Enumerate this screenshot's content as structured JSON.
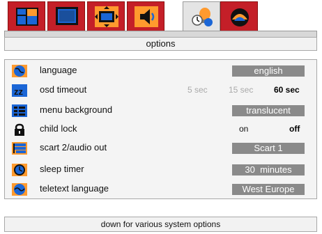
{
  "header": {
    "title": "options"
  },
  "tabs": [
    {
      "icon": "picture-icon",
      "active": false
    },
    {
      "icon": "tv-screen-icon",
      "active": false
    },
    {
      "icon": "screen-format-icon",
      "active": false
    },
    {
      "icon": "sound-icon",
      "active": false
    },
    {
      "icon": "options-bulb-icon",
      "active": true
    },
    {
      "icon": "installation-icon",
      "active": false
    }
  ],
  "settings": {
    "language": {
      "label": "language",
      "value": "english"
    },
    "osd_timeout": {
      "label": "osd timeout",
      "options": [
        "5 sec",
        "15 sec",
        "60 sec"
      ],
      "selected": "60 sec"
    },
    "menu_background": {
      "label": "menu background",
      "value": "translucent"
    },
    "child_lock": {
      "label": "child lock",
      "options": [
        "on",
        "off"
      ],
      "selected": "off"
    },
    "scart_audio_out": {
      "label": "scart 2/audio out",
      "value": "Scart 1"
    },
    "sleep_timer": {
      "label": "sleep timer",
      "value": "30  minutes"
    },
    "teletext_language": {
      "label": "teletext language",
      "value": "West Europe"
    }
  },
  "footer": {
    "hint": "down for various system options"
  },
  "colors": {
    "tab_red": "#c41f28",
    "value_box": "#8a8a8a",
    "icon_blue": "#1b66d6",
    "icon_orange": "#ff9a2e"
  }
}
